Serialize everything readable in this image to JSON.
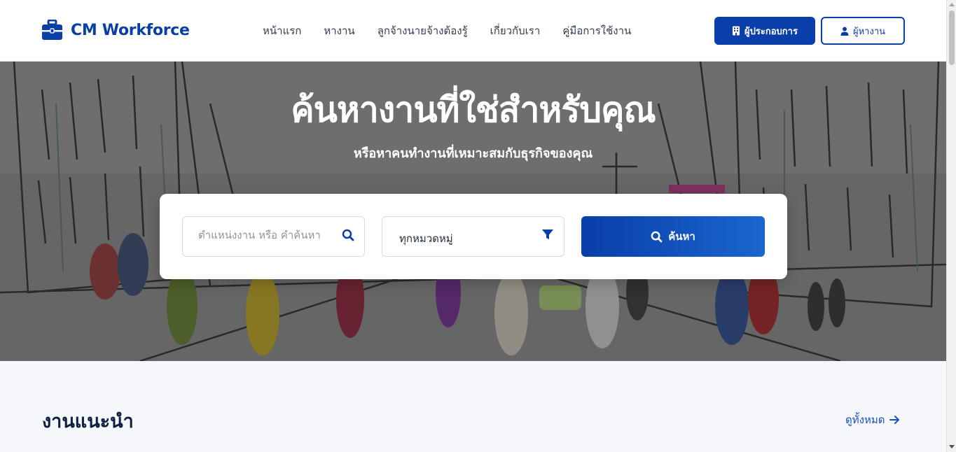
{
  "brand": {
    "name": "CM Workforce",
    "icon": "briefcase-icon",
    "color": "#0b3fa5"
  },
  "nav": {
    "items": [
      {
        "label": "หน้าแรก"
      },
      {
        "label": "หางาน"
      },
      {
        "label": "ลูกจ้างนายจ้างต้องรู้"
      },
      {
        "label": "เกี่ยวกับเรา"
      },
      {
        "label": "คู่มือการใช้งาน"
      }
    ]
  },
  "auth": {
    "employer_label": "ผู้ประกอบการ",
    "employer_icon": "building-icon",
    "jobseeker_label": "ผู้หางาน",
    "jobseeker_icon": "user-icon"
  },
  "hero": {
    "title": "ค้นหางานที่ใช่สำหรับคุณ",
    "subtitle": "หรือหาคนทำงานที่เหมาะสมกับธุรกิจของคุณ"
  },
  "search": {
    "keyword_placeholder": "ตำแหน่งงาน หรือ คำค้นหา",
    "keyword_value": "",
    "category_value": "ทุกหมวดหมู่",
    "button_label": "ค้นหา"
  },
  "recommended": {
    "title": "งานแนะนำ",
    "view_all_label": "ดูทั้งหมด"
  },
  "colors": {
    "primary": "#0a3ea8",
    "accent": "#1a66cf",
    "text_dark": "#0f1f44"
  }
}
